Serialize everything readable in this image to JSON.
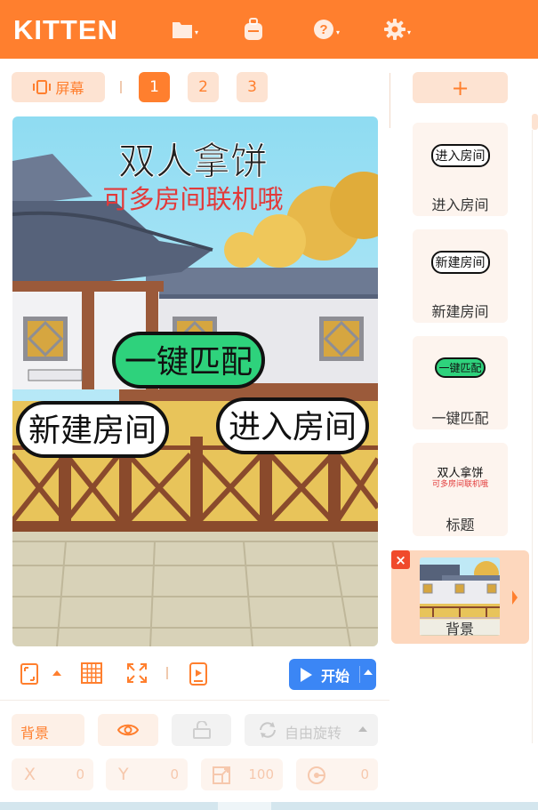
{
  "app": {
    "logo": "KITTEN"
  },
  "topbar": {
    "icons": [
      "folder-icon",
      "backpack-icon",
      "help-icon",
      "gear-icon"
    ],
    "accent": "#ff7f2e"
  },
  "toolbar": {
    "screen_label": "屏幕",
    "pages": [
      "1",
      "2",
      "3"
    ],
    "active_page": "1"
  },
  "stage": {
    "title": "双人拿饼",
    "subtitle": "可多房间联机哦",
    "buttons": {
      "match": "一键匹配",
      "create": "新建房间",
      "join": "进入房间"
    }
  },
  "controls": {
    "start_label": "开始",
    "start_color": "#3b86f5"
  },
  "props": {
    "name": "背景",
    "rotation_mode": "自由旋转",
    "x_label": "X",
    "x_value": "0",
    "y_label": "Y",
    "y_value": "0",
    "size_value": "100",
    "direction_value": "0"
  },
  "sprites": [
    {
      "thumb_text": "进入房间",
      "name": "进入房间"
    },
    {
      "thumb_text": "新建房间",
      "name": "新建房间"
    },
    {
      "thumb_text": "一键匹配",
      "name": "一键匹配"
    },
    {
      "thumb_title": "双人拿饼",
      "thumb_sub": "可多房间联机哦",
      "name": "标题"
    }
  ],
  "background_sprite": {
    "name": "背景",
    "delete_label": "×"
  },
  "add_label": "+"
}
